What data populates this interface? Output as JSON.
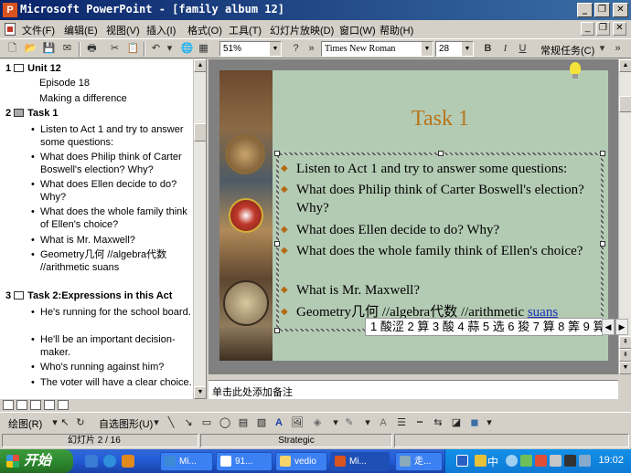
{
  "window": {
    "title": "Microsoft PowerPoint - [family album 12]",
    "app_icon": "P"
  },
  "menu": {
    "items": [
      "文件(F)",
      "编辑(E)",
      "视图(V)",
      "插入(I)",
      "格式(O)",
      "工具(T)",
      "幻灯片放映(D)",
      "窗口(W)",
      "帮助(H)"
    ]
  },
  "toolbar": {
    "zoom": "51%",
    "font_name": "Times New Roman",
    "font_size": "28",
    "bold": "B",
    "italic": "I",
    "underline": "U",
    "task_label": "常规任务(C)"
  },
  "outline": {
    "slides": [
      {
        "num": "1",
        "title": "Unit 12",
        "subs": [
          "Episode 18",
          "Making a difference"
        ]
      },
      {
        "num": "2",
        "title": "Task 1",
        "bullets": [
          "Listen to Act 1 and try to answer some questions:",
          "What does Philip think of Carter Boswell's election? Why?",
          "What does Ellen decide to do? Why?",
          "What does the whole family think of Ellen's choice?",
          "What is Mr. Maxwell?",
          "Geometry几何 //algebra代数 //arithmetic suans"
        ]
      },
      {
        "num": "3",
        "title": "Task 2:Expressions in this Act",
        "bullets": [
          "He's running for the school board.",
          "He'll be an important decision-maker.",
          "Who's running against him?",
          "The voter will have a clear choice."
        ]
      }
    ]
  },
  "slide": {
    "title": "Task 1",
    "bullets": [
      "Listen to Act 1 and try to answer some questions:",
      "What does Philip think of Carter Boswell's election? Why?",
      "What does Ellen decide to do? Why?",
      "What does the whole family think of Ellen's choice?",
      "What is Mr. Maxwell?",
      "Geometry几何 //algebra代数 //arithmetic"
    ],
    "link_word": "suans"
  },
  "ime": {
    "candidates": "1 酸涩 2 算 3 酸 4 蒜 5 选 6 狻 7 算 8 筭 9 算"
  },
  "notes": {
    "placeholder": "单击此处添加备注"
  },
  "drawbar": {
    "draw_label": "绘图(R)",
    "autoshape_label": "自选图形(U)"
  },
  "status": {
    "slide_info": "幻灯片 2 / 16",
    "design": "Strategic"
  },
  "taskbar": {
    "start_label": "开始",
    "tasks": [
      "Mi...",
      "91...",
      "vedio",
      "Mi...",
      "走..."
    ],
    "ime_label": "中",
    "clock": "19:02"
  },
  "colors": {
    "title_bar": "#0a246a",
    "slide_bg": "#b3cbb3",
    "slide_title": "#b8741a",
    "bullet_marker": "#b36a14",
    "taskbar": "#245edb",
    "start_button": "#2f8a2f"
  }
}
